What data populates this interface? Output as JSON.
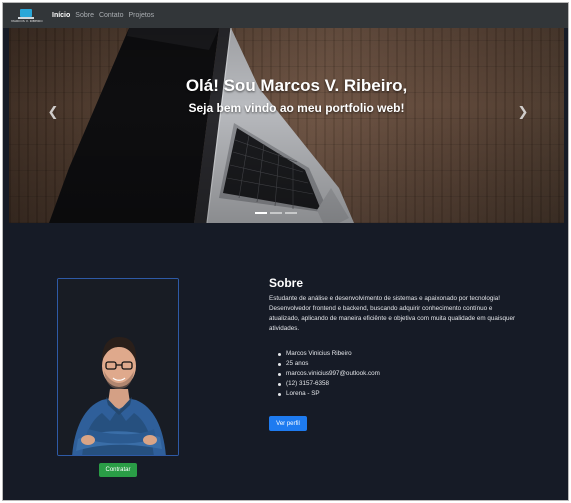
{
  "navbar": {
    "brand_text": "MARCOS V. RIBEIRO",
    "links": [
      {
        "label": "Início",
        "active": true
      },
      {
        "label": "Sobre",
        "active": false
      },
      {
        "label": "Contato",
        "active": false
      },
      {
        "label": "Projetos",
        "active": false
      }
    ]
  },
  "hero": {
    "title": "Olá! Sou Marcos V. Ribeiro,",
    "subtitle": "Seja bem vindo ao meu portfolio web!",
    "prev_icon": "chevron-left-icon",
    "next_icon": "chevron-right-icon",
    "slides_count": 3,
    "active_slide": 1
  },
  "about": {
    "title": "Sobre",
    "description": "Estudante de análise e desenvolvimento de sistemas e apaixonado por tecnologia! Desenvolvedor frontend e backend, buscando adquirir conhecimento contínuo e atualizado, aplicando de maneira eficiênte e objetiva com muita qualidade em quaisquer atividades.",
    "info": [
      "Marcos Vinicius Ribeiro",
      "25 anos",
      "marcos.vinicius997@outlook.com",
      "(12) 3157-6358",
      "Lorena - SP"
    ],
    "profile_button": "Ver perfil",
    "contract_button": "Contratar"
  },
  "colors": {
    "background": "#161b26",
    "navbar": "#323639",
    "primary": "#1e7bf0",
    "success": "#2a9d46",
    "card_border": "#2e5aa6"
  }
}
